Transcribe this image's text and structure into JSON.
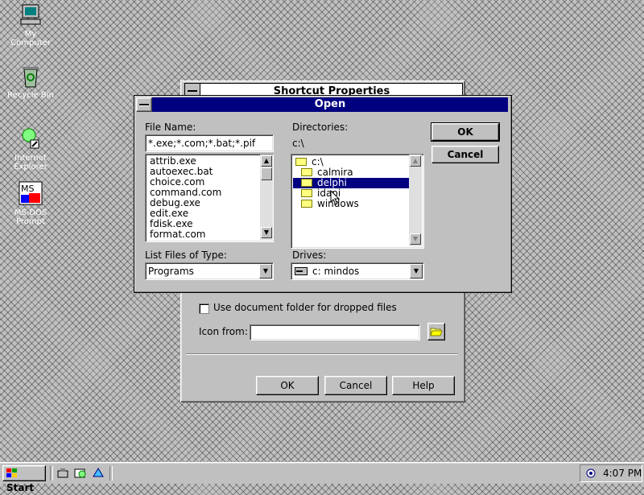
{
  "desktop": {
    "icons": [
      {
        "label": "My Computer",
        "icon": "computer-icon"
      },
      {
        "label": "Recycle Bin",
        "icon": "recycle-bin-icon"
      },
      {
        "label": "Internet Explorer",
        "icon": "explorer-icon"
      },
      {
        "label": "MS-DOS Prompt",
        "icon": "msdos-icon"
      }
    ]
  },
  "shortcut_properties": {
    "title": "Shortcut Properties",
    "use_doc_folder_label": "Use document folder for dropped files",
    "icon_from_label": "Icon from:",
    "icon_from_value": "",
    "ok_label": "OK",
    "cancel_label": "Cancel",
    "help_label": "Help"
  },
  "open_dialog": {
    "title": "Open",
    "file_name_label": "File Name:",
    "file_name_value": "*.exe;*.com;*.bat;*.pif",
    "files": [
      "attrib.exe",
      "autoexec.bat",
      "choice.com",
      "command.com",
      "debug.exe",
      "edit.exe",
      "fdisk.exe",
      "format.com"
    ],
    "list_type_label": "List Files of Type:",
    "list_type_value": "Programs",
    "directories_label": "Directories:",
    "current_dir": "c:\\",
    "dirs": [
      {
        "name": "c:\\",
        "open": true
      },
      {
        "name": "calmira"
      },
      {
        "name": "delphi",
        "selected": true
      },
      {
        "name": "idapi"
      },
      {
        "name": "windows"
      }
    ],
    "drives_label": "Drives:",
    "drive_value": "c: mindos",
    "ok_label": "OK",
    "cancel_label": "Cancel"
  },
  "taskbar": {
    "start_label": "Start",
    "clock": "4:07 PM"
  },
  "colors": {
    "title_active": "#000080",
    "face": "#c0c0c0",
    "selection": "#000080"
  }
}
